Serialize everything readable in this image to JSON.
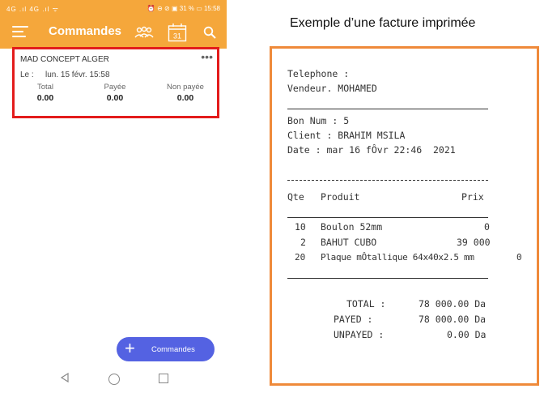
{
  "statusbar": {
    "left_text": "4G .ıl 4G .ıl ᯤ",
    "right_text": "⏰ ⊖ ⊘ ▣ 31 % ▭ 15:58"
  },
  "appbar": {
    "title": "Commandes",
    "calendar_day": "31",
    "icons": [
      "menu-icon",
      "users-icon",
      "calendar-icon",
      "search-icon"
    ]
  },
  "order_card": {
    "client": "MAD CONCEPT ALGER",
    "more": "•••",
    "date_label": "Le :",
    "date_value": "lun. 15 févr. 15:58",
    "totals": [
      {
        "label": "Total",
        "value": "0.00"
      },
      {
        "label": "Payée",
        "value": "0.00"
      },
      {
        "label": "Non payée",
        "value": "0.00"
      }
    ]
  },
  "fab": {
    "label": "Commandes",
    "icon": "plus-icon"
  },
  "navbar": {
    "icons": [
      "back-icon",
      "home-icon",
      "recent-apps-icon"
    ]
  },
  "caption": "Exemple d’une facture imprimée",
  "receipt": {
    "telephone": "Telephone :",
    "vendeur": "Vendeur. MOHAMED",
    "bon": "Bon Num : 5",
    "client": "Client : BRAHIM MSILA",
    "date": "Date : mar 16 fÔvr 22:46  2021",
    "headers": {
      "qte": "Qte",
      "produit": "Produit",
      "prix": "Prix"
    },
    "items": [
      {
        "qte": "10",
        "produit": "Boulon 52mm",
        "prix": "0"
      },
      {
        "qte": "2",
        "produit": "BAHUT CUBO",
        "prix": "39 000"
      },
      {
        "qte": "20",
        "produit": "Plaque mÔtallique 64x40x2.5 mm",
        "prix": "0"
      }
    ],
    "totals": [
      {
        "label": "TOTAL :",
        "value": "78 000.00 Da"
      },
      {
        "label": "PAYED :",
        "value": "78 000.00 Da"
      },
      {
        "label": "UNPAYED :",
        "value": "0.00 Da"
      }
    ]
  }
}
